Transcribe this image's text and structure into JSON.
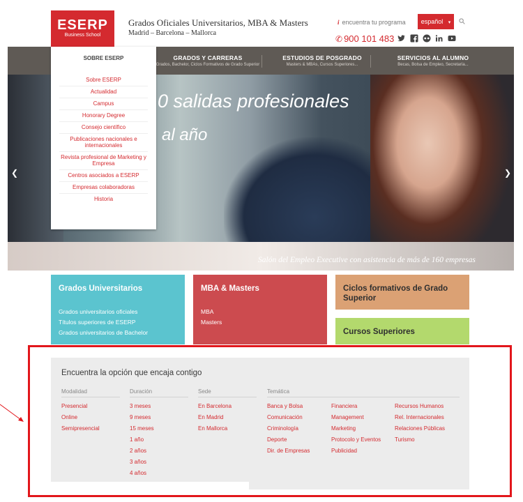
{
  "header": {
    "logo_text": "ESERP",
    "logo_sub": "Business School",
    "tagline": "Grados Oficiales Universitarios, MBA & Masters",
    "cities": "Madrid – Barcelona – Mallorca",
    "finder_icon": "i",
    "finder_label": "encuentra tu programa",
    "language": "español",
    "phone": "900 101 483",
    "social_icons": [
      "twitter-icon",
      "facebook-icon",
      "flickr-icon",
      "linkedin-icon",
      "youtube-icon"
    ]
  },
  "nav": {
    "items": [
      {
        "title": "SOBRE ESERP",
        "sub": ""
      },
      {
        "title": "GRADOS Y CARRERAS",
        "sub": "Grados, Bachelor, Ciclos Formativos de Grado Superior"
      },
      {
        "title": "ESTUDIOS DE POSGRADO",
        "sub": "Masters & MBAs, Cursos Superiores..."
      },
      {
        "title": "SERVICIOS AL ALUMNO",
        "sub": "Becas, Bolsa de Empleo, Secretaría..."
      }
    ]
  },
  "dropdown": {
    "heading": "SOBRE ESERP",
    "items": [
      "Sobre ESERP",
      "Actualidad",
      "Campus",
      "Honorary Degree",
      "Consejo científico",
      "Publicaciones nacionales e internacionales",
      "Revista profesional de Marketing y Empresa",
      "Centros asociados a ESERP",
      "Empresas colaboradoras",
      "Historia"
    ]
  },
  "hero": {
    "headline1": "0 salidas profesionales",
    "headline2": "al año",
    "caption": "Salón del Empleo Executive con asistencia de más de 160 empresas"
  },
  "categories": {
    "grados": {
      "title": "Grados Universitarios",
      "links": [
        "Grados universitarios oficiales",
        "Títulos superiores de ESERP",
        "Grados universitarios de Bachelor"
      ]
    },
    "mba": {
      "title": "MBA & Masters",
      "links": [
        "MBA",
        "Masters"
      ]
    },
    "ciclos": {
      "title": "Ciclos formativos de Grado Superior"
    },
    "cursos": {
      "title": "Cursos Superiores"
    }
  },
  "finder_panel": {
    "title": "Encuentra la opción que encaja contigo",
    "modalidad": {
      "label": "Modalidad",
      "options": [
        "Presencial",
        "Online",
        "Semipresencial"
      ]
    },
    "duracion": {
      "label": "Duración",
      "options": [
        "3 meses",
        "9 meses",
        "15 meses",
        "1 año",
        "2 años",
        "3 años",
        "4 años"
      ]
    },
    "sede": {
      "label": "Sede",
      "options": [
        "En Barcelona",
        "En Madrid",
        "En Mallorca"
      ]
    },
    "tematica": {
      "label": "Temática",
      "col1": [
        "Banca y Bolsa",
        "Comunicación",
        "Criminología",
        "Deporte",
        "Dir. de Empresas"
      ],
      "col2": [
        "Financiera",
        "Management",
        "Marketing",
        "Protocolo y Eventos",
        "Publicidad"
      ],
      "col3": [
        "Recursos Humanos",
        "Rel. Internacionales",
        "Relaciones Públicas",
        "Turismo"
      ]
    }
  },
  "colors": {
    "brand_red": "#d42a2f",
    "nav_bg": "#5f5a55",
    "grados": "#5bc4cf",
    "mba": "#cc4b4f",
    "ciclos": "#dba174",
    "cursos": "#b3d96d",
    "highlight": "#e2161b"
  }
}
